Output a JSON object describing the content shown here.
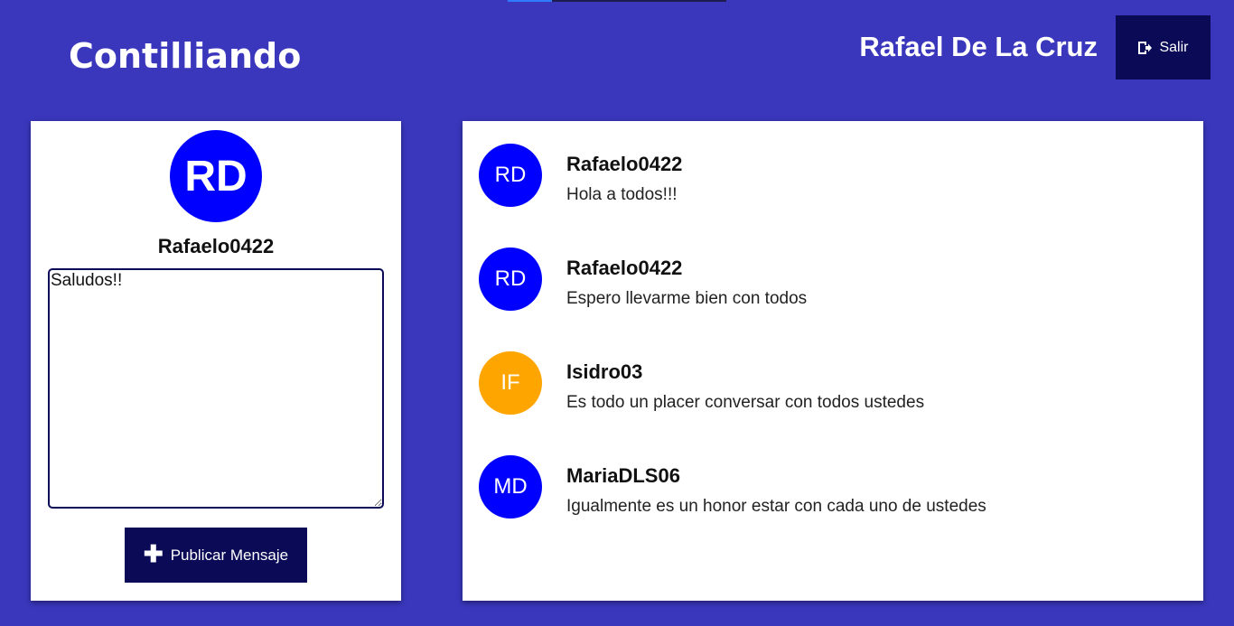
{
  "header": {
    "brand": "Contilliando",
    "user_name": "Rafael De La Cruz",
    "logout_label": "Salir"
  },
  "profile": {
    "initials": "RD",
    "avatar_color": "#0000ff",
    "handle": "Rafaelo0422",
    "compose_value": "Saludos!!",
    "publish_label": "Publicar Mensaje"
  },
  "feed": {
    "messages": [
      {
        "initials": "RD",
        "color": "#0000ff",
        "user": "Rafaelo0422",
        "text": "Hola a todos!!!"
      },
      {
        "initials": "RD",
        "color": "#0000ff",
        "user": "Rafaelo0422",
        "text": "Espero llevarme bien con todos"
      },
      {
        "initials": "IF",
        "color": "#ffa500",
        "user": "Isidro03",
        "text": "Es todo un placer conversar con todos ustedes"
      },
      {
        "initials": "MD",
        "color": "#0000ff",
        "user": "MariaDLS06",
        "text": "Igualmente es un honor estar con cada uno de ustedes"
      }
    ]
  },
  "colors": {
    "background": "#3a37bd",
    "button_dark": "#0b0a57"
  }
}
